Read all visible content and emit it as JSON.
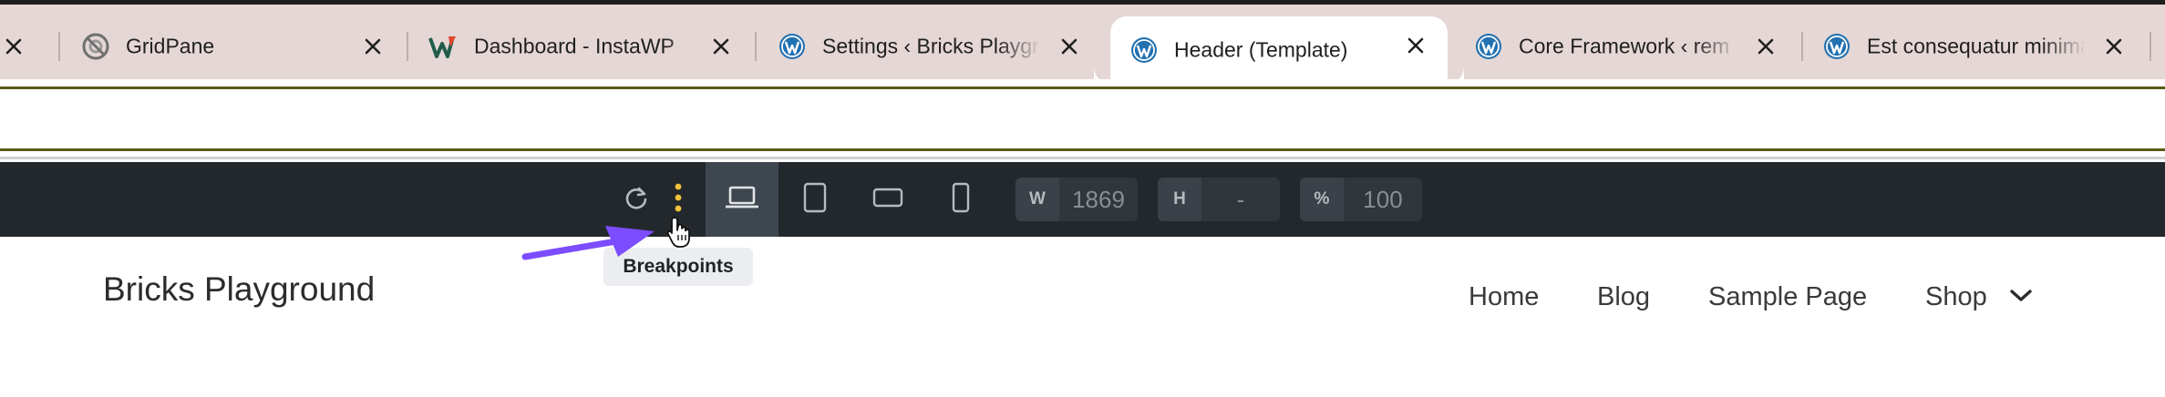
{
  "tabs": [
    {
      "title": "GridPane",
      "favicon": "gridpane-icon",
      "active": false
    },
    {
      "title": "Dashboard - InstaWP",
      "favicon": "instawp-icon",
      "active": false
    },
    {
      "title": "Settings ‹ Bricks Playground",
      "favicon": "wordpress-icon",
      "active": false
    },
    {
      "title": "Header (Template)",
      "favicon": "wordpress-icon",
      "active": true
    },
    {
      "title": "Core Framework ‹ rem",
      "favicon": "wordpress-icon",
      "active": false
    },
    {
      "title": "Est consequatur minima",
      "favicon": "wordpress-icon",
      "active": false
    }
  ],
  "toolbar": {
    "width_label": "W",
    "width_value": "1869",
    "height_label": "H",
    "height_value": "-",
    "zoom_label": "%",
    "zoom_value": "100",
    "tooltip": "Breakpoints",
    "accent_color": "#f0c33c",
    "arrow_color": "#7b4dff"
  },
  "site": {
    "title": "Bricks Playground",
    "nav": [
      "Home",
      "Blog",
      "Sample Page",
      "Shop"
    ]
  }
}
